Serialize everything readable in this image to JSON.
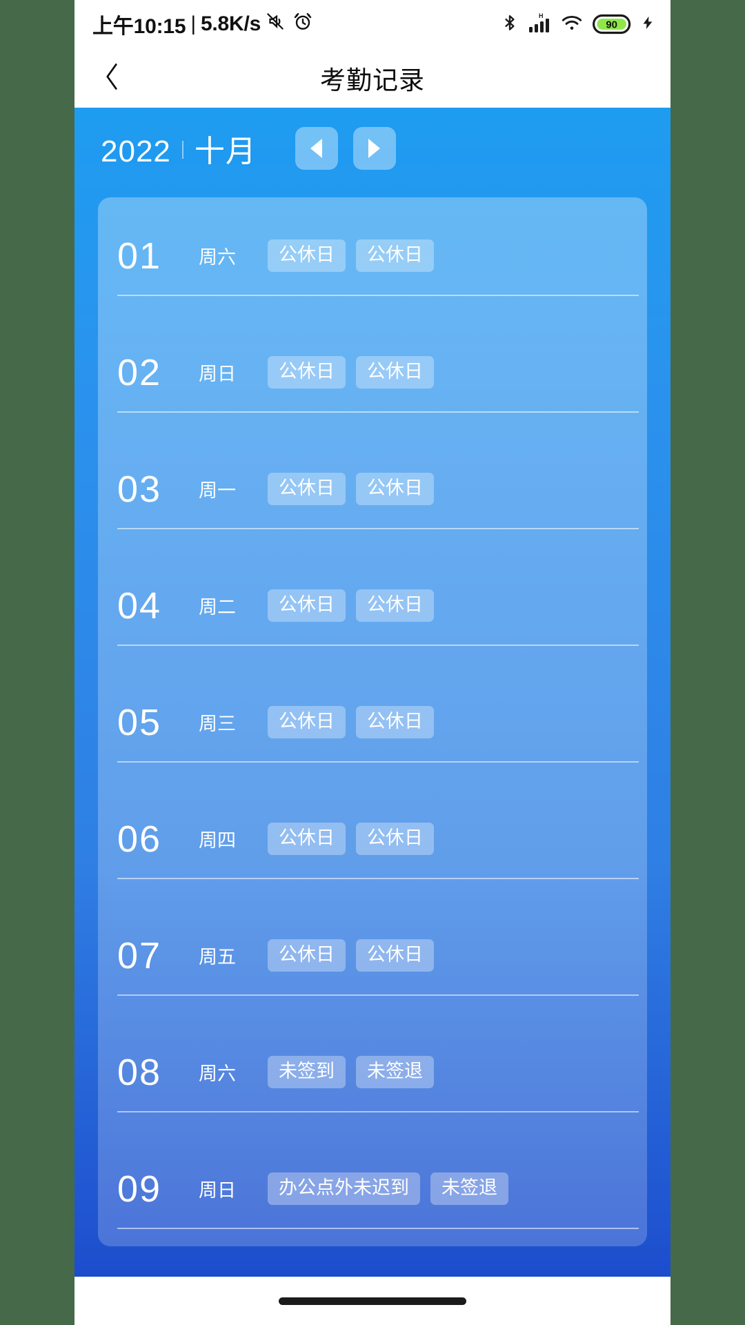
{
  "status_bar": {
    "time": "上午10:15",
    "separator": "|",
    "network_speed": "5.8K/s",
    "icons": [
      "mute-icon",
      "alarm-icon",
      "bluetooth-icon",
      "signal-icon",
      "wifi-icon",
      "battery-icon",
      "charging-icon"
    ],
    "battery_level": "90"
  },
  "header": {
    "back_icon": "chevron-left-icon",
    "title": "考勤记录"
  },
  "month_selector": {
    "year": "2022",
    "divider": "",
    "month": "十月",
    "prev_label": "prev-month",
    "next_label": "next-month"
  },
  "records": [
    {
      "day": "01",
      "weekday": "周六",
      "tags": [
        "公休日",
        "公休日"
      ]
    },
    {
      "day": "02",
      "weekday": "周日",
      "tags": [
        "公休日",
        "公休日"
      ]
    },
    {
      "day": "03",
      "weekday": "周一",
      "tags": [
        "公休日",
        "公休日"
      ]
    },
    {
      "day": "04",
      "weekday": "周二",
      "tags": [
        "公休日",
        "公休日"
      ]
    },
    {
      "day": "05",
      "weekday": "周三",
      "tags": [
        "公休日",
        "公休日"
      ]
    },
    {
      "day": "06",
      "weekday": "周四",
      "tags": [
        "公休日",
        "公休日"
      ]
    },
    {
      "day": "07",
      "weekday": "周五",
      "tags": [
        "公休日",
        "公休日"
      ]
    },
    {
      "day": "08",
      "weekday": "周六",
      "tags": [
        "未签到",
        "未签退"
      ]
    },
    {
      "day": "09",
      "weekday": "周日",
      "tags": [
        "办公点外未迟到",
        "未签退"
      ]
    }
  ],
  "colors": {
    "accent_top": "#1e9cf0",
    "accent_bottom": "#1645c9",
    "card": "rgba(255,255,255,0.28)",
    "tag": "rgba(255,255,255,0.32)",
    "battery_green": "#8ee84a",
    "text_light": "#ffffff",
    "title_dark": "#0d0d0d"
  }
}
